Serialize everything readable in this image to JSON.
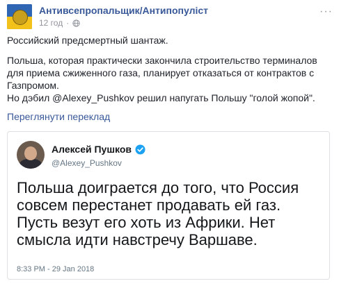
{
  "header": {
    "page_name": "Антивсепропальщик/Антипопуліст",
    "time": "12 год",
    "separator": "·"
  },
  "post": {
    "line1": "Российский предсмертный шантаж.",
    "line2": "Польша, которая практически закончила строительство терминалов для приема сжиженного газа, планирует отказаться от контрактов с Газпромом.",
    "line3": "Но дэбил @Alexey_Pushkov решил напугать Польшу \"голой жопой\".",
    "translate_link": "Переглянути переклад"
  },
  "tweet": {
    "name": "Алексей Пушков",
    "handle": "@Alexey_Pushkov",
    "text": "Польша доиграется до того, что Россия совсем перестанет продавать ей газ. Пусть везут его хоть из Африки. Нет смысла идти навстречу Варшаве.",
    "timestamp": "8:33 PM - 29 Jan 2018"
  },
  "icons": {
    "globe": "globe-icon",
    "more": "more-options-icon",
    "verified": "verified-badge-icon"
  },
  "colors": {
    "link": "#385898",
    "meta": "#90949c",
    "verified": "#1da1f2"
  }
}
